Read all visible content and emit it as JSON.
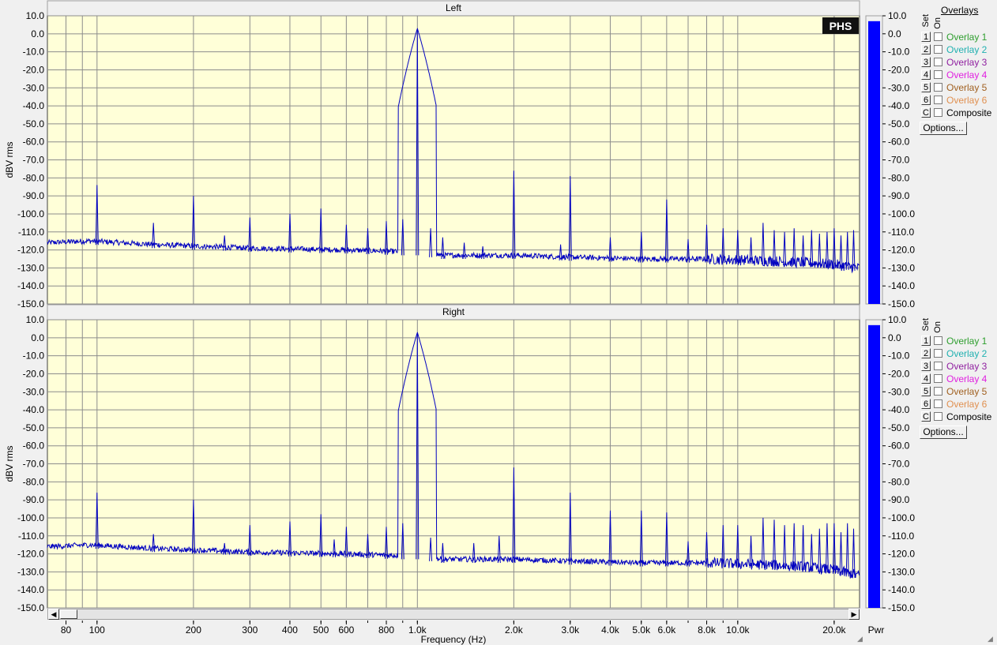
{
  "window": {
    "x_axis_label": "Frequency (Hz)",
    "x_tick_labels": [
      "80",
      "100",
      "200",
      "300",
      "400",
      "500",
      "600",
      "800",
      "1.0k",
      "2.0k",
      "3.0k",
      "4.0k",
      "5.0k",
      "6.0k",
      "8.0k",
      "10.0k",
      "20.0k"
    ],
    "pwr_label": "Pwr",
    "logo": "PHS"
  },
  "overlays": {
    "title": "Overlays",
    "set_header": "Set",
    "on_header": "On",
    "items": [
      {
        "key": "1",
        "label": "Overlay 1",
        "color": "#2e9e2e"
      },
      {
        "key": "2",
        "label": "Overlay 2",
        "color": "#20b0b0"
      },
      {
        "key": "3",
        "label": "Overlay 3",
        "color": "#9020a0"
      },
      {
        "key": "4",
        "label": "Overlay 4",
        "color": "#e020e0"
      },
      {
        "key": "5",
        "label": "Overlay 5",
        "color": "#a06020"
      },
      {
        "key": "6",
        "label": "Overlay 6",
        "color": "#e09050"
      },
      {
        "key": "C",
        "label": "Composite",
        "color": "#000000"
      }
    ],
    "options_label": "Options..."
  },
  "chart_data": [
    {
      "type": "line",
      "title": "Left",
      "xlabel": "Frequency (Hz)",
      "ylabel": "dBV rms",
      "xscale": "log",
      "xlim": [
        70,
        24000
      ],
      "ylim": [
        -150,
        10
      ],
      "y_ticks": [
        10,
        0,
        -10,
        -20,
        -30,
        -40,
        -50,
        -60,
        -70,
        -80,
        -90,
        -100,
        -110,
        -120,
        -130,
        -140,
        -150
      ],
      "y_tick_labels": [
        "10.0",
        "0.0",
        "-10.0",
        "-20.0",
        "-30.0",
        "-40.0",
        "-50.0",
        "-60.0",
        "-70.0",
        "-80.0",
        "-90.0",
        "-100.0",
        "-110.0",
        "-120.0",
        "-130.0",
        "-140.0",
        "-150.0"
      ],
      "grid": true,
      "series": [
        {
          "color": "#0000c0"
        }
      ],
      "noise_floor": [
        [
          70,
          -116
        ],
        [
          95,
          -115
        ],
        [
          150,
          -117
        ],
        [
          300,
          -119
        ],
        [
          600,
          -120
        ],
        [
          900,
          -121
        ],
        [
          1000,
          -121
        ],
        [
          1200,
          -123
        ],
        [
          2000,
          -123
        ],
        [
          3000,
          -124
        ],
        [
          5000,
          -125
        ],
        [
          8000,
          -125
        ],
        [
          12000,
          -126
        ],
        [
          16000,
          -127
        ],
        [
          20000,
          -128
        ],
        [
          24000,
          -130
        ]
      ],
      "peaks": [
        {
          "f": 100,
          "db": -84
        },
        {
          "f": 150,
          "db": -105
        },
        {
          "f": 200,
          "db": -90
        },
        {
          "f": 250,
          "db": -112
        },
        {
          "f": 300,
          "db": -102
        },
        {
          "f": 400,
          "db": -100
        },
        {
          "f": 500,
          "db": -97
        },
        {
          "f": 600,
          "db": -106
        },
        {
          "f": 700,
          "db": -108
        },
        {
          "f": 800,
          "db": -104
        },
        {
          "f": 900,
          "db": -103
        },
        {
          "f": 1000,
          "db": 3
        },
        {
          "f": 1100,
          "db": -108
        },
        {
          "f": 1200,
          "db": -113
        },
        {
          "f": 1400,
          "db": -116
        },
        {
          "f": 1600,
          "db": -118
        },
        {
          "f": 2000,
          "db": -76
        },
        {
          "f": 2800,
          "db": -117
        },
        {
          "f": 3000,
          "db": -79
        },
        {
          "f": 4000,
          "db": -113
        },
        {
          "f": 5000,
          "db": -110
        },
        {
          "f": 6000,
          "db": -92
        },
        {
          "f": 7000,
          "db": -114
        },
        {
          "f": 8000,
          "db": -106
        },
        {
          "f": 9000,
          "db": -108
        },
        {
          "f": 10000,
          "db": -109
        },
        {
          "f": 11000,
          "db": -113
        },
        {
          "f": 12000,
          "db": -105
        },
        {
          "f": 13000,
          "db": -109
        },
        {
          "f": 14000,
          "db": -110
        },
        {
          "f": 15000,
          "db": -108
        },
        {
          "f": 16000,
          "db": -112
        },
        {
          "f": 17000,
          "db": -109
        },
        {
          "f": 18000,
          "db": -111
        },
        {
          "f": 19000,
          "db": -110
        },
        {
          "f": 20000,
          "db": -108
        },
        {
          "f": 21000,
          "db": -112
        },
        {
          "f": 22000,
          "db": -110
        },
        {
          "f": 23000,
          "db": -109
        }
      ],
      "level_bar": {
        "top_db": 7,
        "color": "#0000ff"
      }
    },
    {
      "type": "line",
      "title": "Right",
      "xlabel": "Frequency (Hz)",
      "ylabel": "dBV rms",
      "xscale": "log",
      "xlim": [
        70,
        24000
      ],
      "ylim": [
        -150,
        10
      ],
      "y_ticks": [
        10,
        0,
        -10,
        -20,
        -30,
        -40,
        -50,
        -60,
        -70,
        -80,
        -90,
        -100,
        -110,
        -120,
        -130,
        -140,
        -150
      ],
      "y_tick_labels": [
        "10.0",
        "0.0",
        "-10.0",
        "-20.0",
        "-30.0",
        "-40.0",
        "-50.0",
        "-60.0",
        "-70.0",
        "-80.0",
        "-90.0",
        "-100.0",
        "-110.0",
        "-120.0",
        "-130.0",
        "-140.0",
        "-150.0"
      ],
      "grid": true,
      "series": [
        {
          "color": "#0000c0"
        }
      ],
      "noise_floor": [
        [
          70,
          -116
        ],
        [
          95,
          -115
        ],
        [
          150,
          -117
        ],
        [
          300,
          -119
        ],
        [
          600,
          -120
        ],
        [
          900,
          -121
        ],
        [
          1000,
          -121
        ],
        [
          1200,
          -123
        ],
        [
          2000,
          -123
        ],
        [
          3000,
          -124
        ],
        [
          5000,
          -125
        ],
        [
          8000,
          -125
        ],
        [
          12000,
          -126
        ],
        [
          16000,
          -127
        ],
        [
          20000,
          -129
        ],
        [
          24000,
          -132
        ]
      ],
      "peaks": [
        {
          "f": 100,
          "db": -86
        },
        {
          "f": 150,
          "db": -109
        },
        {
          "f": 200,
          "db": -90
        },
        {
          "f": 250,
          "db": -114
        },
        {
          "f": 300,
          "db": -104
        },
        {
          "f": 400,
          "db": -102
        },
        {
          "f": 500,
          "db": -98
        },
        {
          "f": 550,
          "db": -112
        },
        {
          "f": 600,
          "db": -105
        },
        {
          "f": 700,
          "db": -109
        },
        {
          "f": 800,
          "db": -105
        },
        {
          "f": 900,
          "db": -103
        },
        {
          "f": 1000,
          "db": 3
        },
        {
          "f": 1100,
          "db": -111
        },
        {
          "f": 1200,
          "db": -114
        },
        {
          "f": 1500,
          "db": -114
        },
        {
          "f": 1800,
          "db": -110
        },
        {
          "f": 2000,
          "db": -72
        },
        {
          "f": 3000,
          "db": -86
        },
        {
          "f": 4000,
          "db": -96
        },
        {
          "f": 5000,
          "db": -96
        },
        {
          "f": 6000,
          "db": -97
        },
        {
          "f": 7000,
          "db": -113
        },
        {
          "f": 8000,
          "db": -108
        },
        {
          "f": 9000,
          "db": -104
        },
        {
          "f": 10000,
          "db": -104
        },
        {
          "f": 11000,
          "db": -110
        },
        {
          "f": 12000,
          "db": -100
        },
        {
          "f": 13000,
          "db": -101
        },
        {
          "f": 14000,
          "db": -104
        },
        {
          "f": 15000,
          "db": -103
        },
        {
          "f": 16000,
          "db": -104
        },
        {
          "f": 17000,
          "db": -109
        },
        {
          "f": 18000,
          "db": -106
        },
        {
          "f": 19000,
          "db": -103
        },
        {
          "f": 20000,
          "db": -103
        },
        {
          "f": 21000,
          "db": -108
        },
        {
          "f": 22000,
          "db": -103
        },
        {
          "f": 23000,
          "db": -106
        }
      ],
      "level_bar": {
        "top_db": 7,
        "color": "#0000ff"
      }
    }
  ]
}
